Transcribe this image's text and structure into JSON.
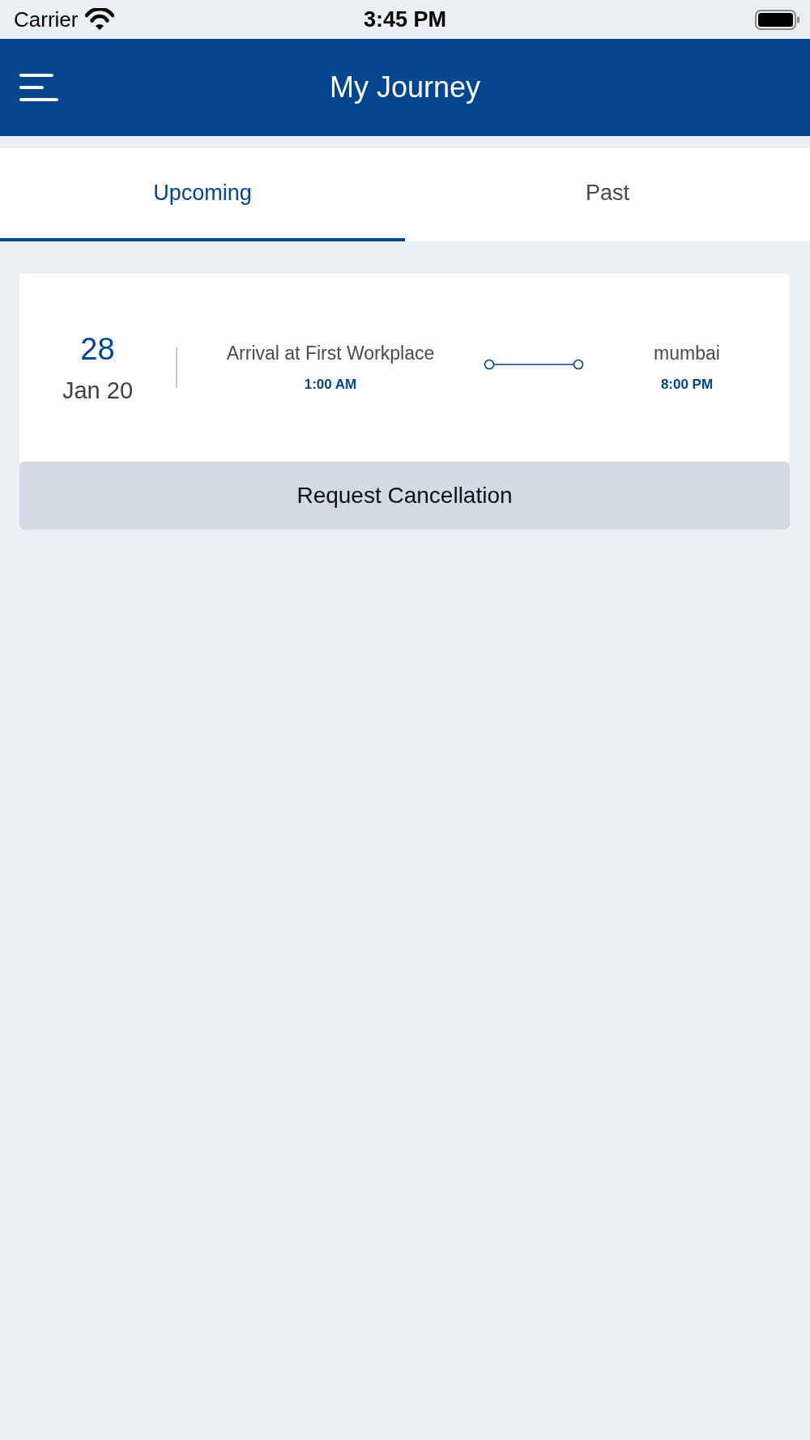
{
  "status_bar": {
    "carrier": "Carrier",
    "time": "3:45 PM"
  },
  "header": {
    "title": "My Journey"
  },
  "tabs": [
    {
      "label": "Upcoming",
      "selected": true
    },
    {
      "label": "Past",
      "selected": false
    }
  ],
  "journeys": [
    {
      "day": "28",
      "month_year": "Jan 20",
      "from": {
        "place": "Arrival at First Workplace",
        "time": "1:00 AM"
      },
      "to": {
        "place": "mumbai",
        "time": "8:00 PM"
      },
      "action": "Request Cancellation"
    }
  ]
}
